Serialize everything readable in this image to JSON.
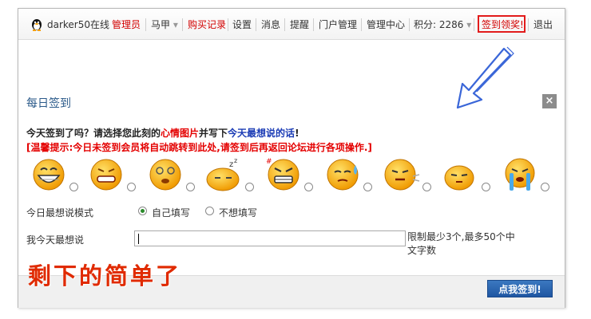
{
  "topbar": {
    "username": "darker50",
    "online": "在线",
    "admin": "管理员",
    "vest": "马甲",
    "purchase": "购买记录",
    "settings": "设置",
    "messages": "消息",
    "reminder": "提醒",
    "portal_admin": "门户管理",
    "admin_center": "管理中心",
    "points": "积分: 2286",
    "signin_reward": "签到领奖!",
    "logout": "退出"
  },
  "dialog": {
    "title": "每日签到",
    "close": "×",
    "question_part1": "今天签到了吗？请选择您此刻的",
    "question_mood": "心情图片",
    "question_part2": "并写下",
    "question_word": "今天最想说的话",
    "question_end": "!",
    "tip": "[温馨提示:今日未签到会员将自动跳转到此处,请签到后再返回论坛进行各项操作.]",
    "emotions": [
      "happy",
      "sad",
      "dizzy",
      "sleepy",
      "angry",
      "sweat",
      "wronged",
      "shy",
      "crying"
    ],
    "mode_label": "今日最想说模式",
    "mode_option_self": "自己填写",
    "mode_option_none": "不想填写",
    "say_label": "我今天最想说",
    "say_value": "",
    "limit_text": "限制最少3个,最多50个中文字数",
    "submit": "点我签到!"
  },
  "overlay_text": "剩下的简单了",
  "colors": {
    "accent_red": "#e40000",
    "title_blue": "#2b5a8a",
    "button_blue": "#1f56a2"
  }
}
